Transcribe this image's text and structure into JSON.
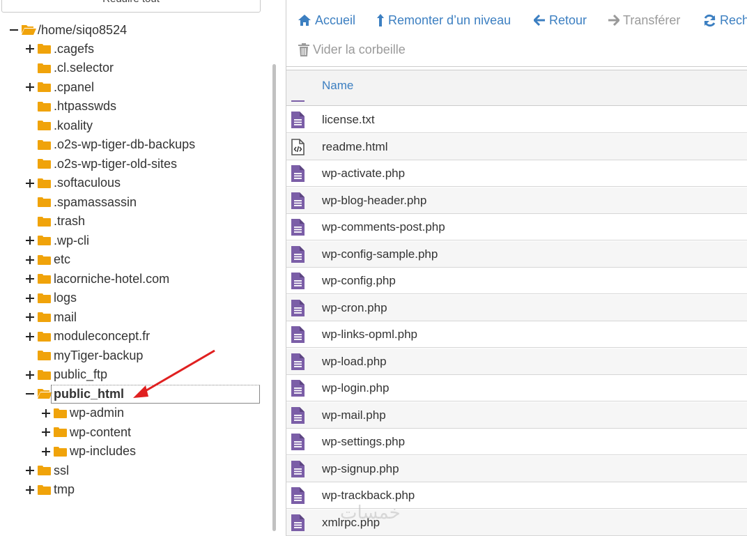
{
  "tree": {
    "collapse_all_label": "Réduire tout",
    "root": {
      "label": "/home/siqo8524",
      "expanded": true
    },
    "items": [
      {
        "label": ".cagefs",
        "toggle": "plus"
      },
      {
        "label": ".cl.selector",
        "toggle": "none"
      },
      {
        "label": ".cpanel",
        "toggle": "plus"
      },
      {
        "label": ".htpasswds",
        "toggle": "none"
      },
      {
        "label": ".koality",
        "toggle": "none"
      },
      {
        "label": ".o2s-wp-tiger-db-backups",
        "toggle": "none"
      },
      {
        "label": ".o2s-wp-tiger-old-sites",
        "toggle": "none"
      },
      {
        "label": ".softaculous",
        "toggle": "plus"
      },
      {
        "label": ".spamassassin",
        "toggle": "none"
      },
      {
        "label": ".trash",
        "toggle": "none"
      },
      {
        "label": ".wp-cli",
        "toggle": "plus"
      },
      {
        "label": "etc",
        "toggle": "plus"
      },
      {
        "label": "lacorniche-hotel.com",
        "toggle": "plus"
      },
      {
        "label": "logs",
        "toggle": "plus"
      },
      {
        "label": "mail",
        "toggle": "plus"
      },
      {
        "label": "moduleconcept.fr",
        "toggle": "plus"
      },
      {
        "label": "myTiger-backup",
        "toggle": "none"
      },
      {
        "label": "public_ftp",
        "toggle": "plus"
      },
      {
        "label": "public_html",
        "toggle": "minus",
        "selected": true
      },
      {
        "label": "wp-admin",
        "toggle": "plus",
        "child": true
      },
      {
        "label": "wp-content",
        "toggle": "plus",
        "child": true
      },
      {
        "label": "wp-includes",
        "toggle": "plus",
        "child": true
      },
      {
        "label": "ssl",
        "toggle": "plus"
      },
      {
        "label": "tmp",
        "toggle": "plus"
      }
    ]
  },
  "toolbar": {
    "home_label": "Accueil",
    "up_label": "Remonter d’un niveau",
    "back_label": "Retour",
    "forward_label": "Transférer",
    "refresh_label": "Rech",
    "empty_trash_label": "Vider la corbeille"
  },
  "table": {
    "column_name": "Name",
    "files": [
      {
        "name": "license.txt",
        "icon": "text-file-icon"
      },
      {
        "name": "readme.html",
        "icon": "code-file-icon"
      },
      {
        "name": "wp-activate.php",
        "icon": "text-file-icon"
      },
      {
        "name": "wp-blog-header.php",
        "icon": "text-file-icon"
      },
      {
        "name": "wp-comments-post.php",
        "icon": "text-file-icon"
      },
      {
        "name": "wp-config-sample.php",
        "icon": "text-file-icon"
      },
      {
        "name": "wp-config.php",
        "icon": "text-file-icon"
      },
      {
        "name": "wp-cron.php",
        "icon": "text-file-icon"
      },
      {
        "name": "wp-links-opml.php",
        "icon": "text-file-icon"
      },
      {
        "name": "wp-load.php",
        "icon": "text-file-icon"
      },
      {
        "name": "wp-login.php",
        "icon": "text-file-icon"
      },
      {
        "name": "wp-mail.php",
        "icon": "text-file-icon"
      },
      {
        "name": "wp-settings.php",
        "icon": "text-file-icon"
      },
      {
        "name": "wp-signup.php",
        "icon": "text-file-icon"
      },
      {
        "name": "wp-trackback.php",
        "icon": "text-file-icon"
      },
      {
        "name": "xmlrpc.php",
        "icon": "text-file-icon"
      }
    ]
  },
  "watermark": "خمسات",
  "colors": {
    "accent": "#3c7fc1",
    "folder": "#f0a30a",
    "file_icon": "#7b5ea7",
    "annotation_arrow": "#e02020"
  }
}
